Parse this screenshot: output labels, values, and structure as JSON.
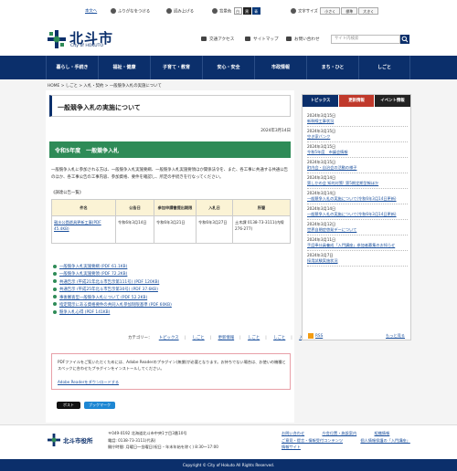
{
  "util": {
    "skip": "本文へ",
    "furigana": "ふりがなをつける",
    "readaloud": "読み上げる",
    "color_label": "背景色",
    "color_white": "白",
    "color_black": "黒",
    "color_blue": "青",
    "size_label": "文字サイズ",
    "size_small": "小さく",
    "size_std": "標準",
    "size_large": "大きく"
  },
  "header": {
    "logo": "北斗市",
    "logo_sub": "City of HOKUTO",
    "access": "交通アクセス",
    "sitemap": "サイトマップ",
    "contact": "お問い合わせ",
    "search_placeholder": "サイト内検索"
  },
  "nav": [
    "暮らし・手続き",
    "福祉・健康",
    "子育て・教育",
    "安心・安全",
    "市政情報",
    "まち・ひと",
    "しごと"
  ],
  "breadcrumb": "HOME > しごと > 入札・契約 > 一般競争入札の実施について",
  "page": {
    "title": "一般競争入札の実施について",
    "date": "2024年3月14日",
    "section": "令和5年度　一般競争入札",
    "intro": "一般競争入札に参加される方は、一般競争入札実施要綱、一般競争入札実施要領ほか関係法令を、また、各工事に共通する共通公告のほか、各工事公告の工事内容、参加資格、要件を確認し、所定の手続きを行なってください。",
    "sched_label": "《調達公告一覧》",
    "table": {
      "headers": [
        "件名",
        "公告日",
        "参加申請書提出期限",
        "入札日",
        "所管"
      ],
      "row": {
        "name": "親水公園遊具更新工事(PDF 45.4KB)",
        "notice": "令和6年3月14日",
        "deadline": "令和6年3月21日",
        "bid": "令和6年3月27日",
        "dept": "土木課 0138-73-3111(内線276-277)"
      }
    },
    "docs": [
      "一般競争入札実施要綱 (PDF 61.1KB)",
      "一般競争入札実施要領 (PDF 72.2KB)",
      "共通告示 (平成21年北斗市告示第111号) (PDF 120KB)",
      "共通告示 (平成25年北斗市告示第30号) (PDF 37.6KB)",
      "事後審査型一般競争入札について (PDF 52.2KB)",
      "指定開示にある資格要件の共同入札参加制限基準 (PDF 60KB)",
      "競争入札心得 (PDF 141KB)"
    ],
    "cat_label": "カテゴリー：",
    "categories": [
      "トピックス",
      "しごと",
      "更新情報",
      "しごと",
      "しごと",
      "入札・契約"
    ],
    "pdf_text": "PDFファイルをご覧いただくためには、Adobe Readerのプラグイン(無償)が必要となります。お持ちでない場合は、お使いの機種とスペックに合わせたプラグインをインストールしてください。",
    "pdf_link": "Adobe Readerをダウンロードする",
    "share_x": "ポスト",
    "share_b": "ブックマーク"
  },
  "side": {
    "tabs": [
      "トピックス",
      "更新情報",
      "イベント情報"
    ],
    "news": [
      {
        "date": "2024年3月15日",
        "title": "新幹線工事状況"
      },
      {
        "date": "2024年3月15日",
        "title": "空き家バンク"
      },
      {
        "date": "2024年3月15日",
        "title": "令和5年度　市議会情報"
      },
      {
        "date": "2024年3月15日",
        "title": "町内会・自治会の活動の様子"
      },
      {
        "date": "2024年3月14日",
        "title": "第しかの会 知的対策! 第5期定期型報ほか"
      },
      {
        "date": "2024年3月14日",
        "title": "一般競争入札の実施について(令和6年3月14日更新)"
      },
      {
        "date": "2024年3月14日",
        "title": "一般競争入札の実施について(令和6年3月14日更新)"
      },
      {
        "date": "2024年3月12日",
        "title": "世界自閉症啓発デーについて"
      },
      {
        "date": "2024年3月11日",
        "title": "手話奉仕員養成「入門講座」参加者募集のお知らせ"
      },
      {
        "date": "2024年3月7日",
        "title": "採用試験実施状況"
      }
    ],
    "rss": "RSS",
    "more": "もっと見る"
  },
  "footer": {
    "name": "北斗市役所",
    "addr1": "〒049-0192 北海道北斗市中央1丁目3番10号",
    "addr2": "電話: 0138-73-3111(代表)",
    "addr3": "開庁時間: 月曜日～金曜日(祝日・年末年始を除く) 8:30～17:00",
    "links": [
      "お問い合わせ",
      "庁舎位置・施設案内",
      "組織情報"
    ],
    "links2": [
      "ご意見・提言・情報受付コンテンツ",
      "個人情報保護の「入門講座」",
      "情報サイト"
    ],
    "copyright": "Copyright © City of Hokuto All Rights Reserved."
  }
}
